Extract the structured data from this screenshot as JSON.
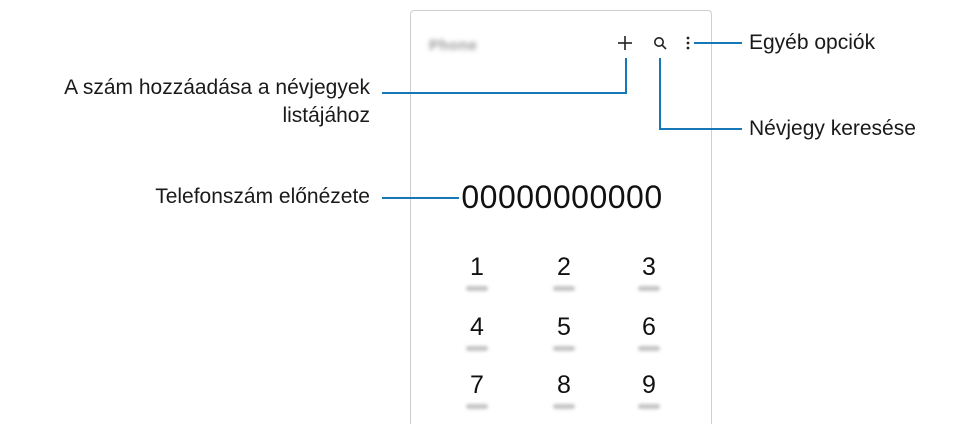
{
  "phone": {
    "title": "Phone",
    "number_preview": "00000000000",
    "keys": [
      {
        "digit": "1"
      },
      {
        "digit": "2"
      },
      {
        "digit": "3"
      },
      {
        "digit": "4"
      },
      {
        "digit": "5"
      },
      {
        "digit": "6"
      },
      {
        "digit": "7"
      },
      {
        "digit": "8"
      },
      {
        "digit": "9"
      }
    ]
  },
  "callouts": {
    "add_to_contacts_line1": "A szám hozzáadása a névjegyek",
    "add_to_contacts_line2": "listájához",
    "more_options": "Egyéb opciók",
    "search_contacts": "Névjegy keresése",
    "number_preview": "Telefonszám előnézete"
  },
  "colors": {
    "callout_line": "#1678b6",
    "phone_border": "#cfcfcf"
  },
  "icons": [
    "plus-icon",
    "search-icon",
    "more-options-icon"
  ]
}
